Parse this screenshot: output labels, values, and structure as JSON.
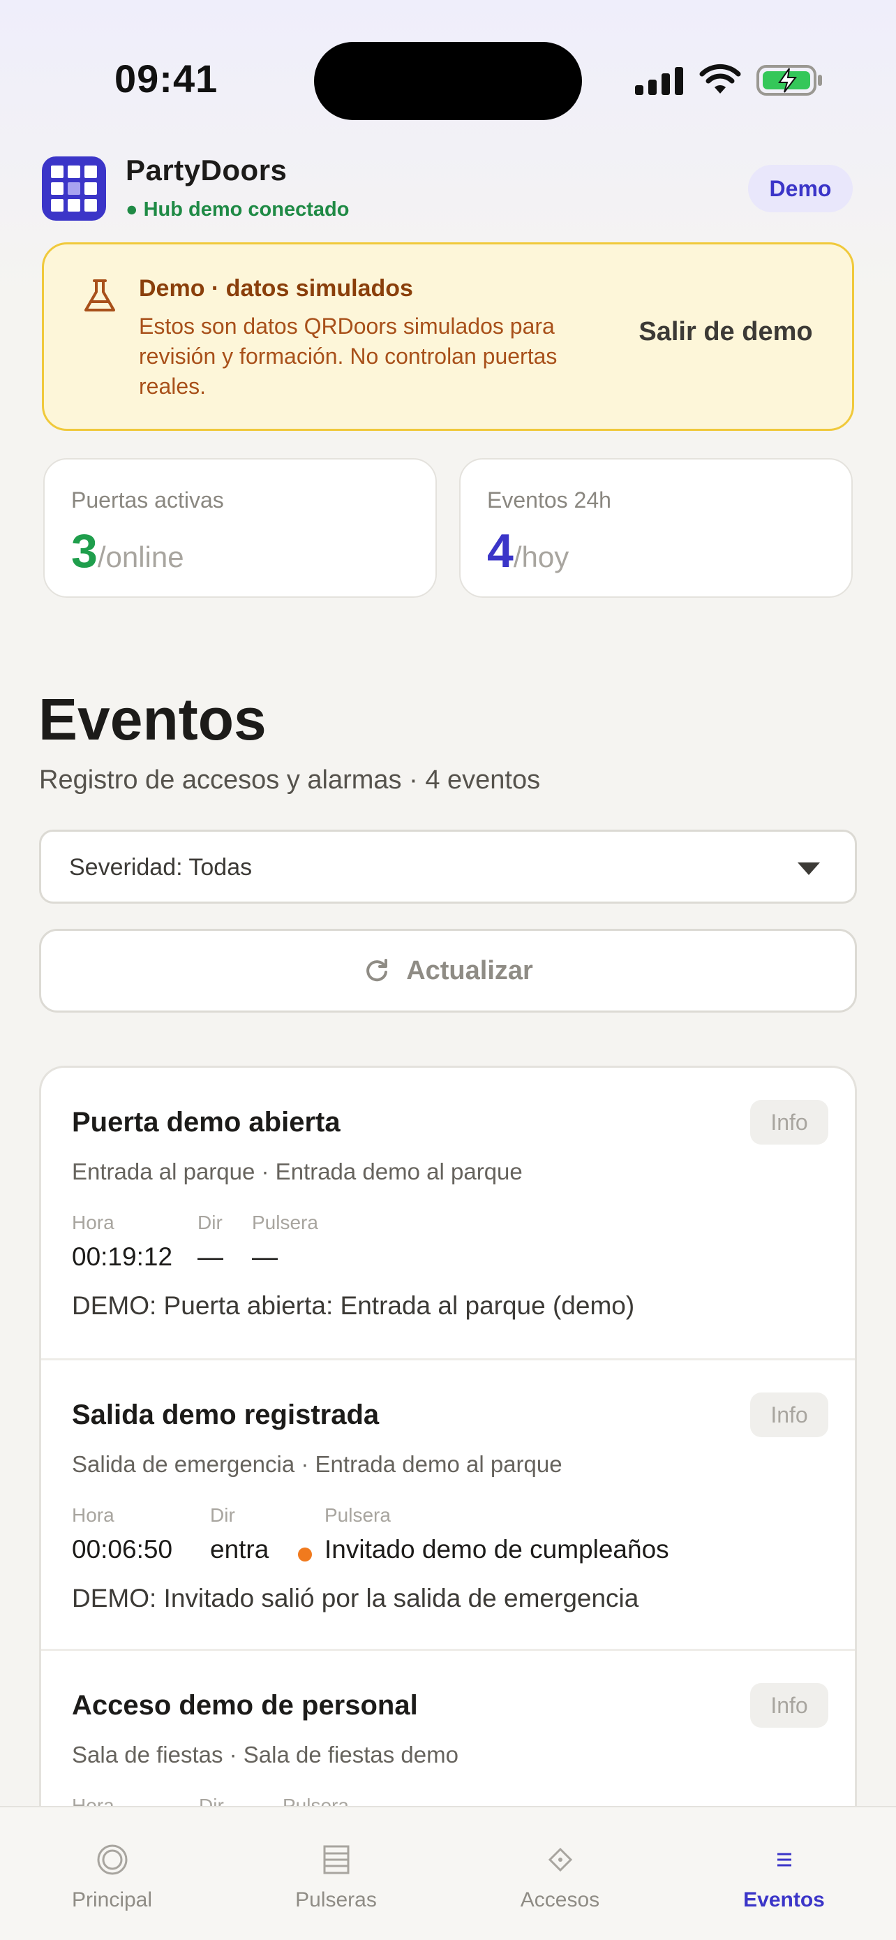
{
  "status_bar": {
    "time": "09:41"
  },
  "app": {
    "name": "PartyDoors",
    "hub_status": "● Hub demo conectado",
    "mode_chip": "Demo"
  },
  "demo_banner": {
    "title": "Demo · datos simulados",
    "text": "Estos son datos QRDoors simulados para revisión y formación. No controlan puertas reales.",
    "exit_button": "Salir de demo"
  },
  "stats": [
    {
      "label": "Puertas activas",
      "value": "3",
      "unit": "/online",
      "color": "#1f9e4c"
    },
    {
      "label": "Eventos 24h",
      "value": "4",
      "unit": "/hoy",
      "color": "#3b35c8"
    }
  ],
  "section": {
    "title": "Eventos",
    "subtitle": "Registro de accesos y alarmas · 4 eventos"
  },
  "filter": {
    "selected": "Severidad: Todas"
  },
  "refresh_button": "Actualizar",
  "meta_labels": {
    "time": "Hora",
    "direction": "Dir",
    "wristband": "Pulsera"
  },
  "events": [
    {
      "title": "Puerta demo abierta",
      "severity": "Info",
      "location": "Entrada al parque · Entrada demo al parque",
      "time": "00:19:12",
      "direction": "—",
      "wristband": "—",
      "message": "DEMO: Puerta abierta: Entrada al parque (demo)"
    },
    {
      "title": "Salida demo registrada",
      "severity": "Info",
      "location": "Salida de emergencia · Entrada demo al parque",
      "time": "00:06:50",
      "direction": "entra",
      "wristband": "Invitado demo de cumpleaños",
      "message": "DEMO: Invitado salió por la salida de emergencia"
    },
    {
      "title": "Acceso demo de personal",
      "severity": "Info",
      "location": "Sala de fiestas · Sala de fiestas demo",
      "time": "",
      "direction": "",
      "wristband": "",
      "message": ""
    }
  ],
  "tabs": [
    {
      "label": "Principal",
      "icon": "home-circle-icon",
      "active": false
    },
    {
      "label": "Pulseras",
      "icon": "list-icon",
      "active": false
    },
    {
      "label": "Accesos",
      "icon": "diamond-icon",
      "active": false
    },
    {
      "label": "Eventos",
      "icon": "menu-lines-icon",
      "active": true
    }
  ],
  "colors": {
    "accent": "#3b35c8",
    "success": "#1f9e4c",
    "warning_bg": "#fdf6d9",
    "warning_border": "#f0c93b",
    "warning_text": "#a8501a",
    "wristband_dot": "#f07a1e"
  }
}
